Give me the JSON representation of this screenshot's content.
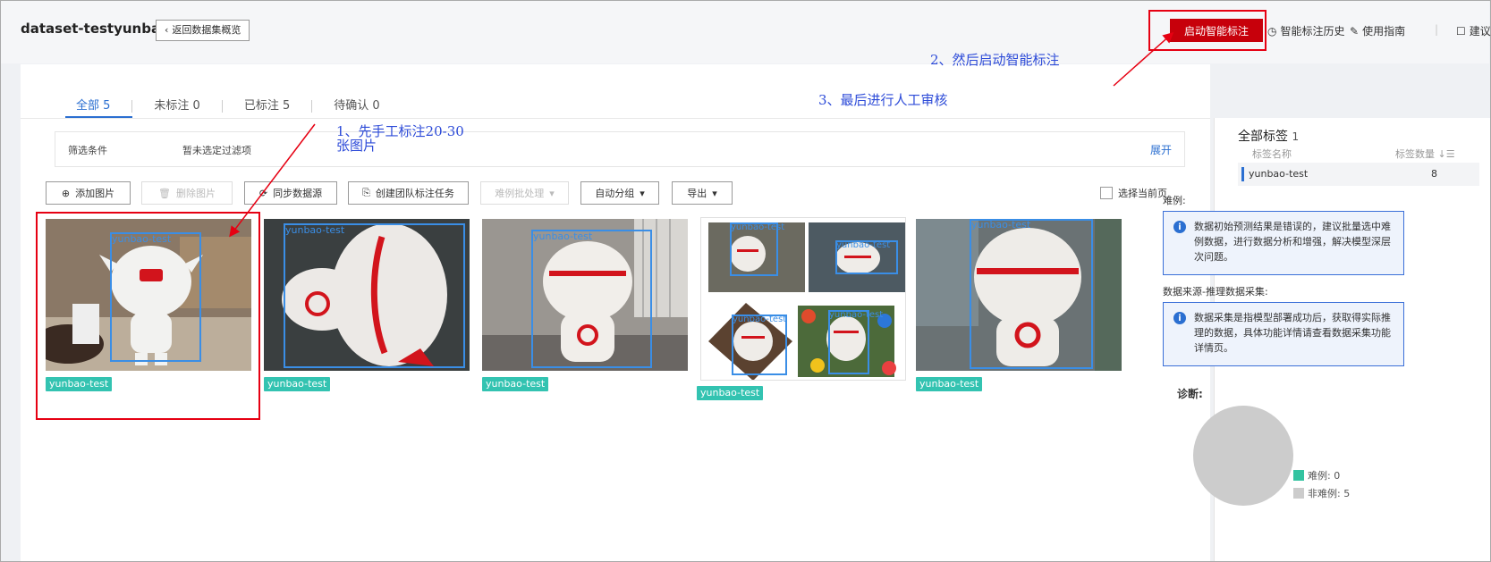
{
  "header": {
    "dataset_name": "dataset-testyunbao",
    "back_label": "返回数据集概览",
    "start_button": "启动智能标注",
    "history_link": "智能标注历史",
    "guide_link": "使用指南",
    "feedback_link": "建议",
    "accent_color": "#c7000b"
  },
  "tabs": [
    {
      "label": "全部 5"
    },
    {
      "label": "未标注 0"
    },
    {
      "label": "已标注 5"
    },
    {
      "label": "待确认 0"
    }
  ],
  "filter": {
    "label": "筛选条件",
    "value": "暂未选定过滤项",
    "expand": "展开"
  },
  "toolbar": {
    "add_image": "添加图片",
    "delete_image": "删除图片",
    "sync_source": "同步数据源",
    "create_team_task": "创建团队标注任务",
    "hard_batch": "难例批处理",
    "auto_group": "自动分组",
    "export": "导出",
    "select_page": "选择当前页"
  },
  "images": [
    {
      "tag": "yunbao-test",
      "boxes": [
        {
          "label": "yunbao-test"
        }
      ]
    },
    {
      "tag": "yunbao-test",
      "boxes": [
        {
          "label": "yunbao-test"
        }
      ]
    },
    {
      "tag": "yunbao-test",
      "boxes": [
        {
          "label": "yunbao-test"
        }
      ]
    },
    {
      "tag": "yunbao-test",
      "boxes": [
        {
          "label": "yunbao-test"
        },
        {
          "label": "yunbao-test"
        },
        {
          "label": "yunbao-test"
        },
        {
          "label": "yunbao-test"
        }
      ]
    },
    {
      "tag": "yunbao-test",
      "boxes": [
        {
          "label": "yunbao-test"
        }
      ]
    }
  ],
  "annotations": {
    "step1_line1": "1、先手工标注20-30",
    "step1_line2": "张图片",
    "step2": "2、然后启动智能标注",
    "step3": "3、最后进行人工审核"
  },
  "right_panel": {
    "title": "全部标签",
    "count": "1",
    "col_name": "标签名称",
    "col_count": "标签数量",
    "label_name": "yunbao-test",
    "label_count": "8",
    "hard_title": "难例:",
    "hard_info": "数据初始预测结果是错误的，建议批量选中难例数据，进行数据分析和增强，解决模型深层次问题。",
    "source_title": "数据来源-推理数据采集:",
    "source_info": "数据采集是指模型部署成功后，获取得实际推理的数据，具体功能详情请查看数据采集功能详情页。",
    "diagnosis": "诊断:",
    "legend_hard": "难例: 0",
    "legend_nonhard": "非难例: 5",
    "pie": {
      "hard": 0,
      "nonhard": 5
    },
    "colors": {
      "hard": "#33c3a0",
      "nonhard": "#cccccc"
    }
  }
}
